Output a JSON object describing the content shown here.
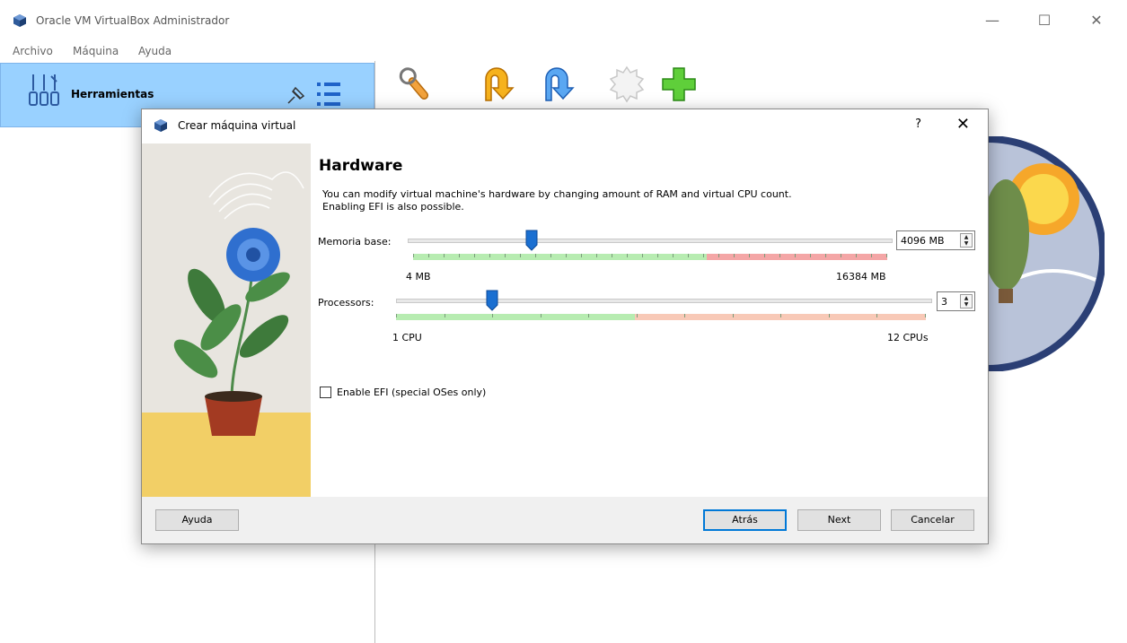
{
  "window": {
    "title": "Oracle VM VirtualBox Administrador",
    "controls": {
      "minimize": "—",
      "maximize": "☐",
      "close": "✕"
    }
  },
  "menu": {
    "items": [
      "Archivo",
      "Máquina",
      "Ayuda"
    ]
  },
  "sidebar": {
    "tools_label": "Herramientas"
  },
  "toolbar": {
    "icons": [
      "wrench-icon",
      "import-icon",
      "export-icon",
      "cloud-icon",
      "new-icon"
    ]
  },
  "dialog": {
    "title": "Crear máquina virtual",
    "help_glyph": "?",
    "close_glyph": "✕",
    "page_title": "Hardware",
    "description_line1": "You can modify virtual machine's hardware by changing amount of RAM and virtual CPU count.",
    "description_line2": "Enabling EFI is also possible.",
    "memory": {
      "label": "Memoria base:",
      "value": "4096 MB",
      "min_label": "4 MB",
      "max_label": "16384 MB",
      "current_mb": 4096,
      "min_mb": 4,
      "max_mb": 16384
    },
    "processors": {
      "label": "Processors:",
      "value": "3",
      "min_label": "1 CPU",
      "max_label": "12 CPUs",
      "current": 3,
      "min": 1,
      "max": 12
    },
    "efi": {
      "label": "Enable EFI (special OSes only)",
      "checked": false
    },
    "buttons": {
      "help": "Ayuda",
      "back": "Atrás",
      "next": "Next",
      "cancel": "Cancelar"
    }
  },
  "colors": {
    "selection": "#99d1ff",
    "slider_handle": "#1a6fd1",
    "range_good": "#b7ecb1",
    "range_warn": "#f8c9b7",
    "range_bad": "#f4a6a6"
  }
}
